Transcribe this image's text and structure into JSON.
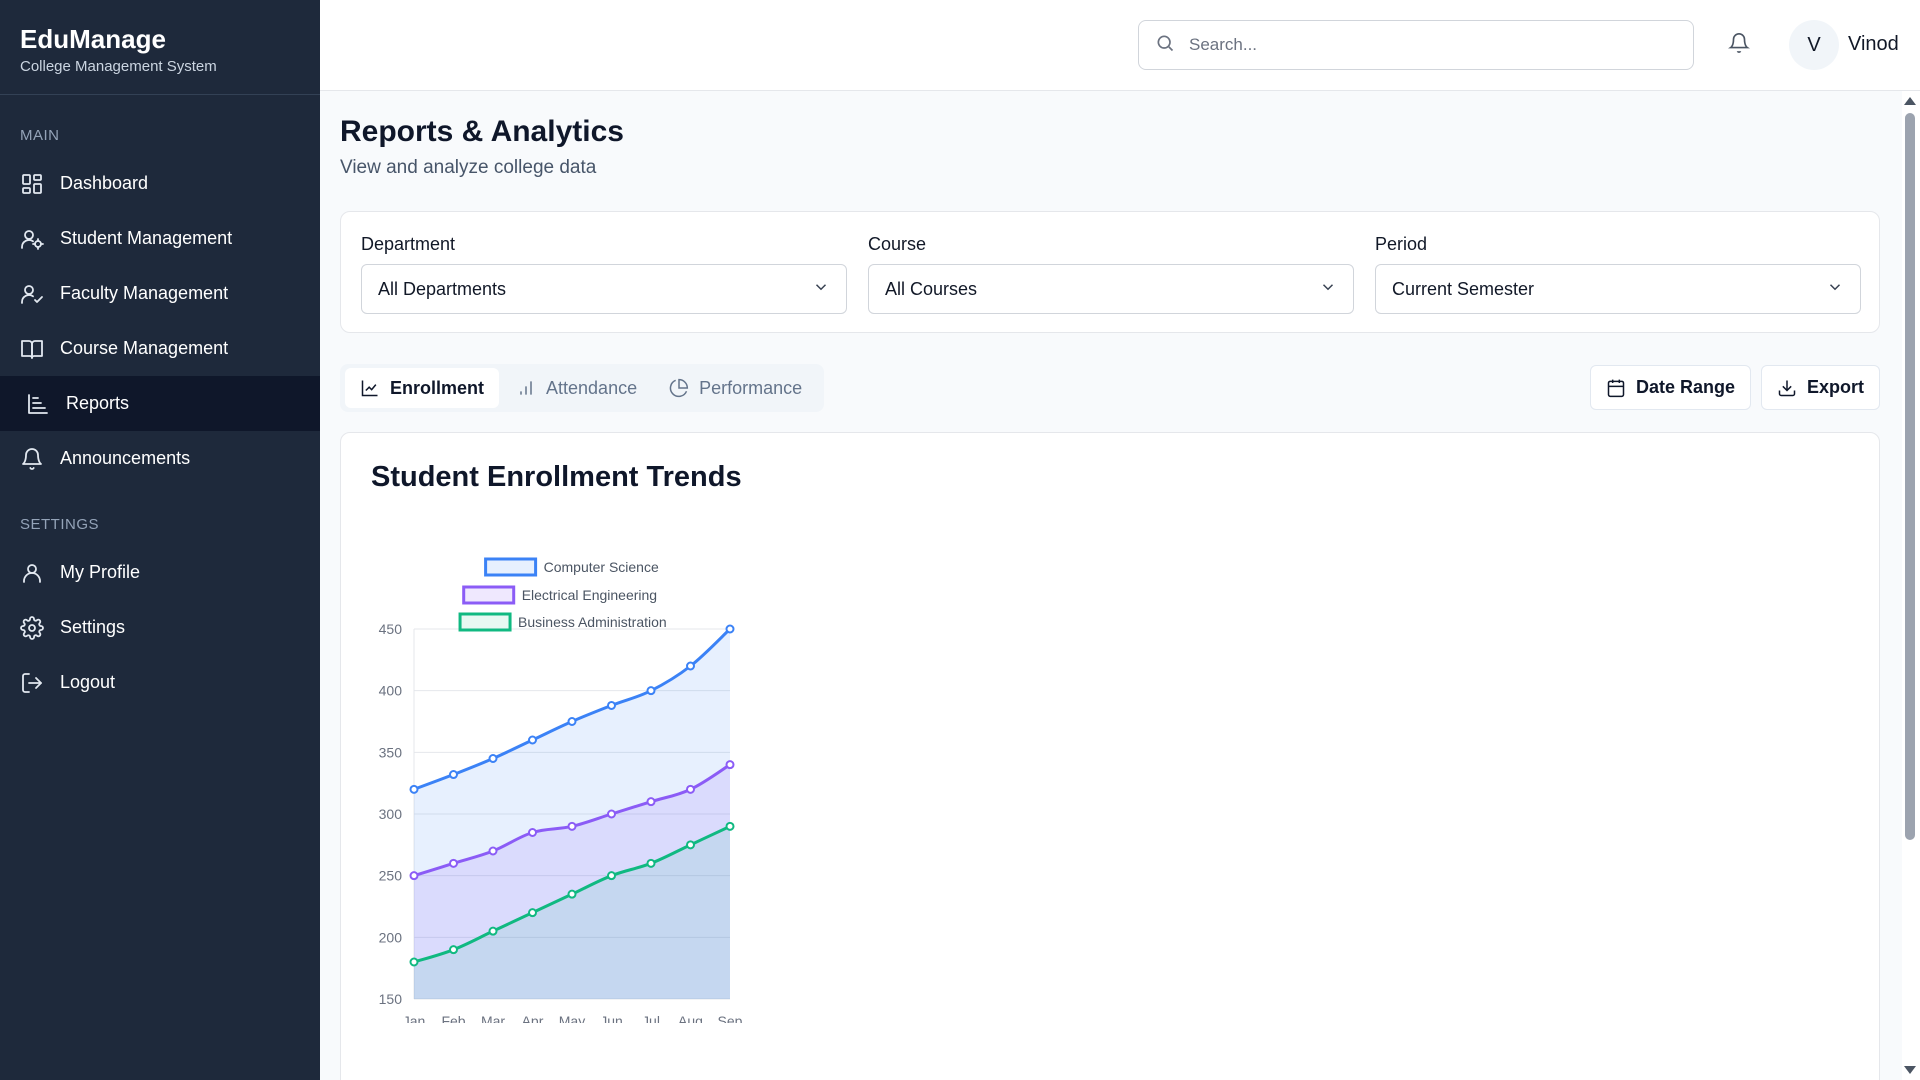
{
  "brand": {
    "title": "EduManage",
    "subtitle": "College Management System"
  },
  "sidebar": {
    "main_label": "MAIN",
    "settings_label": "SETTINGS",
    "main_items": [
      {
        "label": "Dashboard",
        "icon": "dashboard-icon"
      },
      {
        "label": "Student Management",
        "icon": "student-icon"
      },
      {
        "label": "Faculty Management",
        "icon": "faculty-icon"
      },
      {
        "label": "Course Management",
        "icon": "book-icon"
      },
      {
        "label": "Reports",
        "icon": "reports-icon",
        "active": true
      },
      {
        "label": "Announcements",
        "icon": "bell-icon"
      }
    ],
    "settings_items": [
      {
        "label": "My Profile",
        "icon": "user-icon"
      },
      {
        "label": "Settings",
        "icon": "gear-icon"
      },
      {
        "label": "Logout",
        "icon": "logout-icon"
      }
    ]
  },
  "header": {
    "search_placeholder": "Search...",
    "avatar_initial": "V",
    "username": "Vinod"
  },
  "page": {
    "title": "Reports & Analytics",
    "subtitle": "View and analyze college data"
  },
  "filters": {
    "department": {
      "label": "Department",
      "value": "All Departments"
    },
    "course": {
      "label": "Course",
      "value": "All Courses"
    },
    "period": {
      "label": "Period",
      "value": "Current Semester"
    }
  },
  "tabs": [
    {
      "label": "Enrollment",
      "icon": "line-chart-icon",
      "active": true
    },
    {
      "label": "Attendance",
      "icon": "bar-chart-icon"
    },
    {
      "label": "Performance",
      "icon": "pie-chart-icon"
    }
  ],
  "actions": {
    "date_range": "Date Range",
    "export": "Export"
  },
  "chart_card": {
    "title": "Student Enrollment Trends"
  },
  "colors": {
    "sidebar_bg": "#1e293b",
    "cs": "#3b82f6",
    "ee": "#8b5cf6",
    "ba": "#10b981"
  },
  "chart_data": {
    "type": "line",
    "x": [
      "Jan",
      "Feb",
      "Mar",
      "Apr",
      "May",
      "Jun",
      "Jul",
      "Aug",
      "Sep"
    ],
    "ylim": [
      150,
      450
    ],
    "yticks": [
      150,
      200,
      250,
      300,
      350,
      400,
      450
    ],
    "legend_position": "top",
    "fill": true,
    "grid": true,
    "series": [
      {
        "name": "Computer Science",
        "color": "#3b82f6",
        "values": [
          320,
          332,
          345,
          360,
          375,
          388,
          400,
          420,
          450
        ]
      },
      {
        "name": "Electrical Engineering",
        "color": "#8b5cf6",
        "values": [
          250,
          260,
          270,
          285,
          290,
          300,
          310,
          320,
          340
        ]
      },
      {
        "name": "Business Administration",
        "color": "#10b981",
        "values": [
          180,
          190,
          205,
          220,
          235,
          250,
          260,
          275,
          290
        ]
      }
    ]
  }
}
